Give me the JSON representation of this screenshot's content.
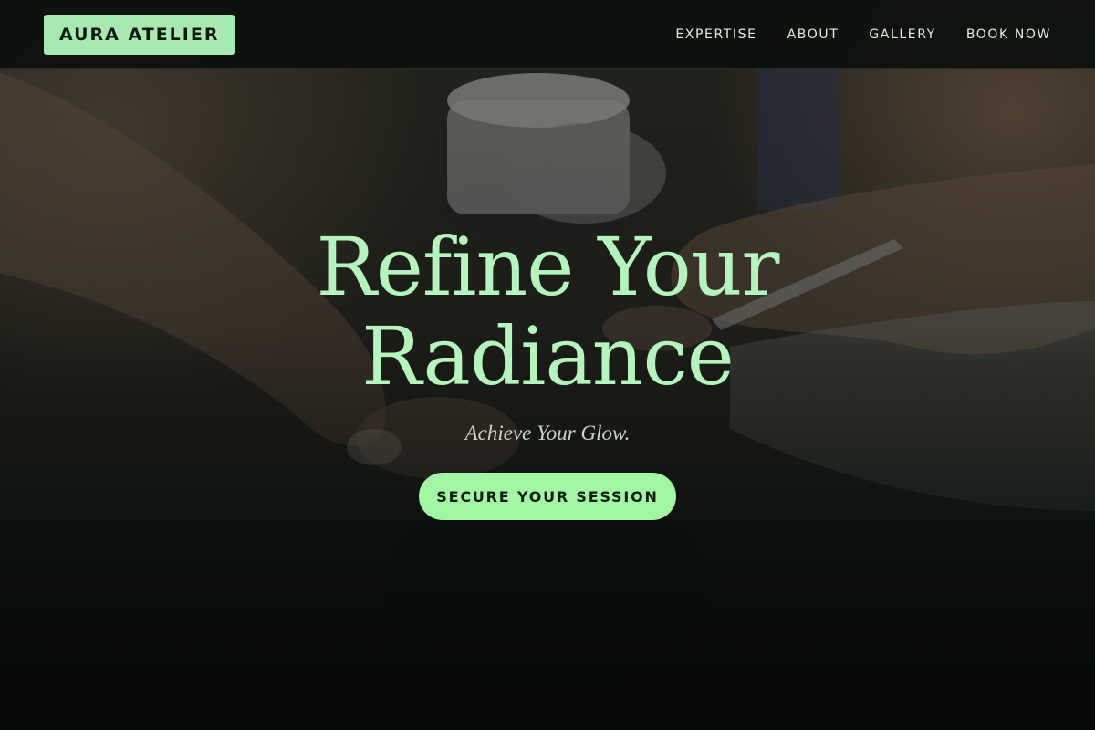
{
  "header": {
    "brand": "AURA ATELIER",
    "nav": [
      {
        "label": "EXPERTISE"
      },
      {
        "label": "ABOUT"
      },
      {
        "label": "GALLERY"
      },
      {
        "label": "BOOK NOW"
      }
    ]
  },
  "hero": {
    "title_line1": "Refine Your",
    "title_line2": "Radiance",
    "subtitle": "Achieve Your Glow.",
    "cta_label": "SECURE YOUR SESSION",
    "background_image": "manicure-hands-photo"
  },
  "colors": {
    "accent": "#a2f7a4",
    "title": "#b3f5bc",
    "brand_bg": "#a8e9b0",
    "header_bg": "#0c100d",
    "page_bg": "#0c0f0b"
  }
}
